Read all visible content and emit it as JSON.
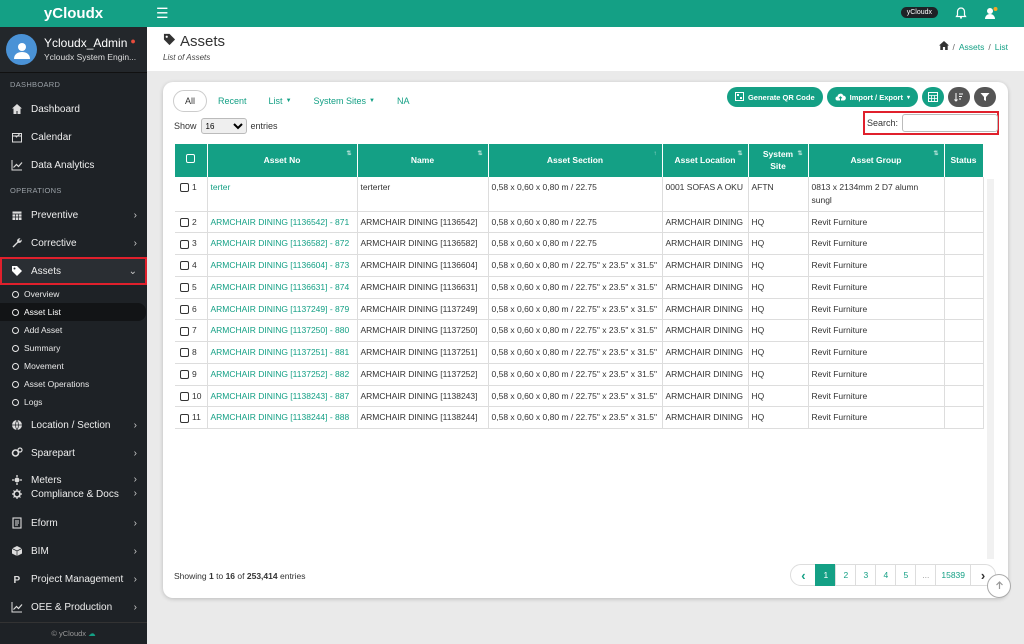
{
  "app": {
    "brand": "yCloudx",
    "badge": "yCloudx",
    "copyright": "© yCloudx"
  },
  "user": {
    "name": "Ycloudx_Admin",
    "role": "Ycloudx System Engin..."
  },
  "sidebar": {
    "sections": {
      "dashboard": "DASHBOARD",
      "operations": "OPERATIONS"
    },
    "dashboard_items": [
      {
        "label": "Dashboard",
        "icon": "home-icon"
      },
      {
        "label": "Calendar",
        "icon": "calendar-icon"
      },
      {
        "label": "Data Analytics",
        "icon": "chart-icon"
      }
    ],
    "ops_items": [
      {
        "label": "Preventive",
        "icon": "calendar-grid-icon"
      },
      {
        "label": "Corrective",
        "icon": "wrench-icon"
      },
      {
        "label": "Assets",
        "icon": "tag-icon"
      }
    ],
    "asset_sub": [
      "Overview",
      "Asset List",
      "Add Asset",
      "Summary",
      "Movement",
      "Asset Operations",
      "Logs"
    ],
    "more_items": [
      {
        "label": "Location / Section",
        "icon": "globe-icon"
      },
      {
        "label": "Sparepart",
        "icon": "cogs-icon"
      },
      {
        "label": "Meters",
        "icon": "meter-icon"
      },
      {
        "label": "Compliance & Docs",
        "icon": "gear-icon"
      },
      {
        "label": "Eform",
        "icon": "form-icon"
      },
      {
        "label": "BIM",
        "icon": "cube-icon"
      },
      {
        "label": "Project Management",
        "icon": "p-icon"
      },
      {
        "label": "OEE & Production",
        "icon": "chart-icon"
      }
    ]
  },
  "page": {
    "title": "Assets",
    "subtitle": "List of Assets",
    "breadcrumb": {
      "assets": "Assets",
      "list": "List"
    }
  },
  "tabs": [
    "All",
    "Recent",
    "List",
    "System Sites",
    "NA"
  ],
  "actions": {
    "qr": "Generate QR Code",
    "import": "Import / Export"
  },
  "controls": {
    "show_label": "Show",
    "show_value": "16",
    "entries_label": "entries",
    "search_label": "Search:",
    "search_value": ""
  },
  "table": {
    "columns": [
      "Asset No",
      "Name",
      "Asset Section",
      "Asset Location",
      "System Site",
      "Asset Group",
      "Status"
    ],
    "rows": [
      {
        "n": "1",
        "no": "terter",
        "name": "terterter",
        "section": "0,58 x 0,60 x 0,80 m / 22.75",
        "location": "0001 SOFAS A OKU",
        "site": "AFTN",
        "group": "0813 x 2134mm 2 D7 alumn sungl",
        "status": ""
      },
      {
        "n": "2",
        "no": "ARMCHAIR DINING [1136542] - 871",
        "name": "ARMCHAIR DINING [1136542]",
        "section": "0,58 x 0,60 x 0,80 m / 22.75",
        "location": "ARMCHAIR DINING",
        "site": "HQ",
        "group": "Revit Furniture",
        "status": ""
      },
      {
        "n": "3",
        "no": "ARMCHAIR DINING [1136582] - 872",
        "name": "ARMCHAIR DINING [1136582]",
        "section": "0,58 x 0,60 x 0,80 m / 22.75",
        "location": "ARMCHAIR DINING",
        "site": "HQ",
        "group": "Revit Furniture",
        "status": ""
      },
      {
        "n": "4",
        "no": "ARMCHAIR DINING [1136604] - 873",
        "name": "ARMCHAIR DINING [1136604]",
        "section": "0,58 x 0,60 x 0,80 m / 22.75\" x 23.5\" x 31.5\"",
        "location": "ARMCHAIR DINING",
        "site": "HQ",
        "group": "Revit Furniture",
        "status": ""
      },
      {
        "n": "5",
        "no": "ARMCHAIR DINING [1136631] - 874",
        "name": "ARMCHAIR DINING [1136631]",
        "section": "0,58 x 0,60 x 0,80 m / 22.75\" x 23.5\" x 31.5\"",
        "location": "ARMCHAIR DINING",
        "site": "HQ",
        "group": "Revit Furniture",
        "status": ""
      },
      {
        "n": "6",
        "no": "ARMCHAIR DINING [1137249] - 879",
        "name": "ARMCHAIR DINING [1137249]",
        "section": "0,58 x 0,60 x 0,80 m / 22.75\" x 23.5\" x 31.5\"",
        "location": "ARMCHAIR DINING",
        "site": "HQ",
        "group": "Revit Furniture",
        "status": ""
      },
      {
        "n": "7",
        "no": "ARMCHAIR DINING [1137250] - 880",
        "name": "ARMCHAIR DINING [1137250]",
        "section": "0,58 x 0,60 x 0,80 m / 22.75\" x 23.5\" x 31.5\"",
        "location": "ARMCHAIR DINING",
        "site": "HQ",
        "group": "Revit Furniture",
        "status": ""
      },
      {
        "n": "8",
        "no": "ARMCHAIR DINING [1137251] - 881",
        "name": "ARMCHAIR DINING [1137251]",
        "section": "0,58 x 0,60 x 0,80 m / 22.75\" x 23.5\" x 31.5\"",
        "location": "ARMCHAIR DINING",
        "site": "HQ",
        "group": "Revit Furniture",
        "status": ""
      },
      {
        "n": "9",
        "no": "ARMCHAIR DINING [1137252] - 882",
        "name": "ARMCHAIR DINING [1137252]",
        "section": "0,58 x 0,60 x 0,80 m / 22.75\" x 23.5\" x 31.5\"",
        "location": "ARMCHAIR DINING",
        "site": "HQ",
        "group": "Revit Furniture",
        "status": ""
      },
      {
        "n": "10",
        "no": "ARMCHAIR DINING [1138243] - 887",
        "name": "ARMCHAIR DINING [1138243]",
        "section": "0,58 x 0,60 x 0,80 m / 22.75\" x 23.5\" x 31.5\"",
        "location": "ARMCHAIR DINING",
        "site": "HQ",
        "group": "Revit Furniture",
        "status": ""
      },
      {
        "n": "11",
        "no": "ARMCHAIR DINING [1138244] - 888",
        "name": "ARMCHAIR DINING [1138244]",
        "section": "0,58 x 0,60 x 0,80 m / 22.75\" x 23.5\" x 31.5\"",
        "location": "ARMCHAIR DINING",
        "site": "HQ",
        "group": "Revit Furniture",
        "status": ""
      }
    ]
  },
  "footer": {
    "showing": "Showing",
    "start": "1",
    "to": "to",
    "end": "16",
    "of": "of",
    "total": "253,414",
    "entries": "entries"
  },
  "pagination": {
    "prev": "‹",
    "pages": [
      "1",
      "2",
      "3",
      "4",
      "5",
      "...",
      "15839"
    ],
    "next": "›"
  },
  "colors": {
    "accent": "#14a085",
    "sidebar": "#1e2226",
    "highlight": "#e0202c"
  }
}
